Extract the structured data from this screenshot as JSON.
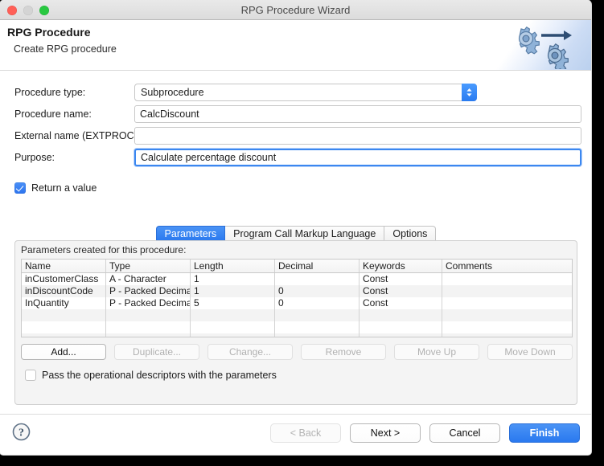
{
  "window": {
    "title": "RPG Procedure Wizard",
    "traffic_lights": [
      "close-button",
      "minimize-button",
      "zoom-button"
    ]
  },
  "banner": {
    "heading": "RPG Procedure",
    "subheading": "Create RPG procedure",
    "icon": "gears-arrow-icon"
  },
  "form": {
    "procedure_type": {
      "label": "Procedure type:",
      "value": "Subprocedure"
    },
    "procedure_name": {
      "label": "Procedure name:",
      "value": "CalcDiscount"
    },
    "external_name": {
      "label": "External name (EXTPROC):",
      "value": ""
    },
    "purpose": {
      "label": "Purpose:",
      "value": "Calculate percentage discount"
    },
    "return_value": {
      "label": "Return a value",
      "checked": true
    }
  },
  "tabs": [
    {
      "label": "Parameters",
      "active": true
    },
    {
      "label": "Program Call Markup Language",
      "active": false
    },
    {
      "label": "Options",
      "active": false
    }
  ],
  "parameters_panel": {
    "caption": "Parameters created for this procedure:",
    "columns": [
      "Name",
      "Type",
      "Length",
      "Decimal",
      "Keywords",
      "Comments"
    ],
    "rows": [
      [
        "inCustomerClass",
        "A - Character",
        "1",
        "",
        "Const",
        ""
      ],
      [
        "inDiscountCode",
        "P - Packed Decimal",
        "1",
        "0",
        "Const",
        ""
      ],
      [
        "InQuantity",
        "P - Packed Decimal",
        "5",
        "0",
        "Const",
        ""
      ],
      [
        "",
        "",
        "",
        "",
        "",
        ""
      ],
      [
        "",
        "",
        "",
        "",
        "",
        ""
      ],
      [
        "",
        "",
        "",
        "",
        "",
        ""
      ]
    ],
    "buttons": [
      {
        "label": "Add...",
        "enabled": true
      },
      {
        "label": "Duplicate...",
        "enabled": false
      },
      {
        "label": "Change...",
        "enabled": false
      },
      {
        "label": "Remove",
        "enabled": false
      },
      {
        "label": "Move Up",
        "enabled": false
      },
      {
        "label": "Move Down",
        "enabled": false
      }
    ],
    "operational_descriptors": {
      "label": "Pass the operational descriptors with the parameters",
      "checked": false
    }
  },
  "footer": {
    "help_icon": "help-question-icon",
    "buttons": [
      {
        "label": "< Back",
        "state": "disabled"
      },
      {
        "label": "Next >",
        "state": "normal"
      },
      {
        "label": "Cancel",
        "state": "normal"
      },
      {
        "label": "Finish",
        "state": "primary"
      }
    ]
  },
  "colors": {
    "accent": "#2a79ef",
    "titlebar": "#e1e1e1",
    "panel": "#f4f4f4",
    "close": "#ff5f57",
    "minimize": "#d4d4d4",
    "zoom": "#28c840"
  }
}
